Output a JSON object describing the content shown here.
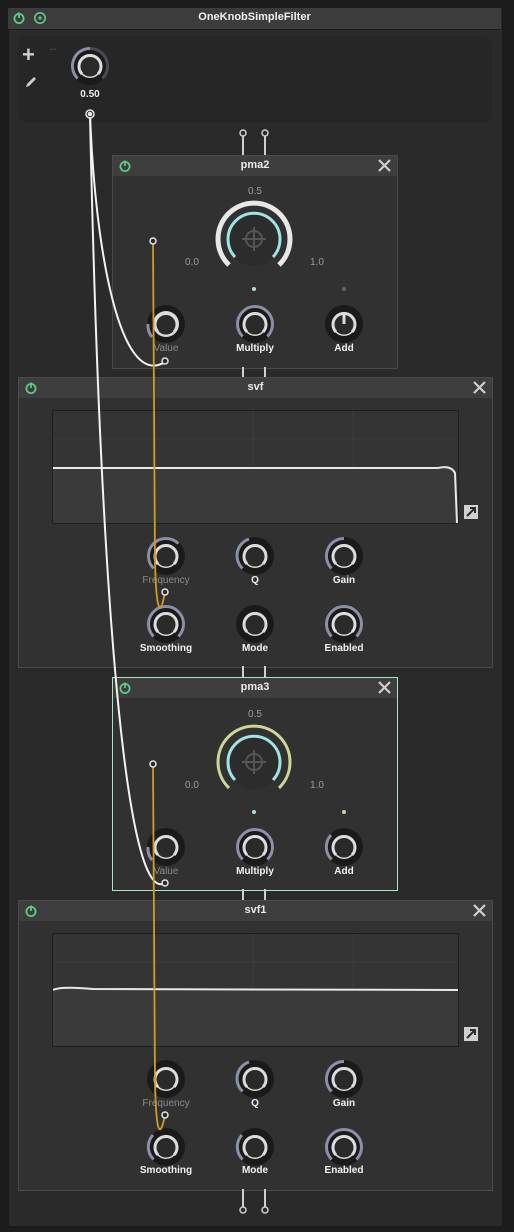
{
  "window": {
    "title": "OneKnobSimpleFilter"
  },
  "macro": {
    "value": "0.50",
    "add_icon": "plus-icon",
    "edit_icon": "pencil-icon"
  },
  "pma2": {
    "title": "pma2",
    "center_value": "0.5",
    "min_label": "0.0",
    "max_label": "1.0",
    "knobs": [
      "Value",
      "Multiply",
      "Add"
    ]
  },
  "svf": {
    "title": "svf",
    "knobs_row1": [
      "Frequency",
      "Q",
      "Gain"
    ],
    "knobs_row2": [
      "Smoothing",
      "Mode",
      "Enabled"
    ]
  },
  "pma3": {
    "title": "pma3",
    "center_value": "0.5",
    "min_label": "0.0",
    "max_label": "1.0",
    "knobs": [
      "Value",
      "Multiply",
      "Add"
    ]
  },
  "svf1": {
    "title": "svf1",
    "knobs_row1": [
      "Frequency",
      "Q",
      "Gain"
    ],
    "knobs_row2": [
      "Smoothing",
      "Mode",
      "Enabled"
    ]
  },
  "colors": {
    "power": "#5fc98a",
    "modulation_wire": "#d39a24",
    "accent": "#9fe3e3",
    "selected_border": "#a8e6c1"
  },
  "icons": {
    "power": "power-icon",
    "close": "close-icon",
    "expand": "expand-icon"
  }
}
